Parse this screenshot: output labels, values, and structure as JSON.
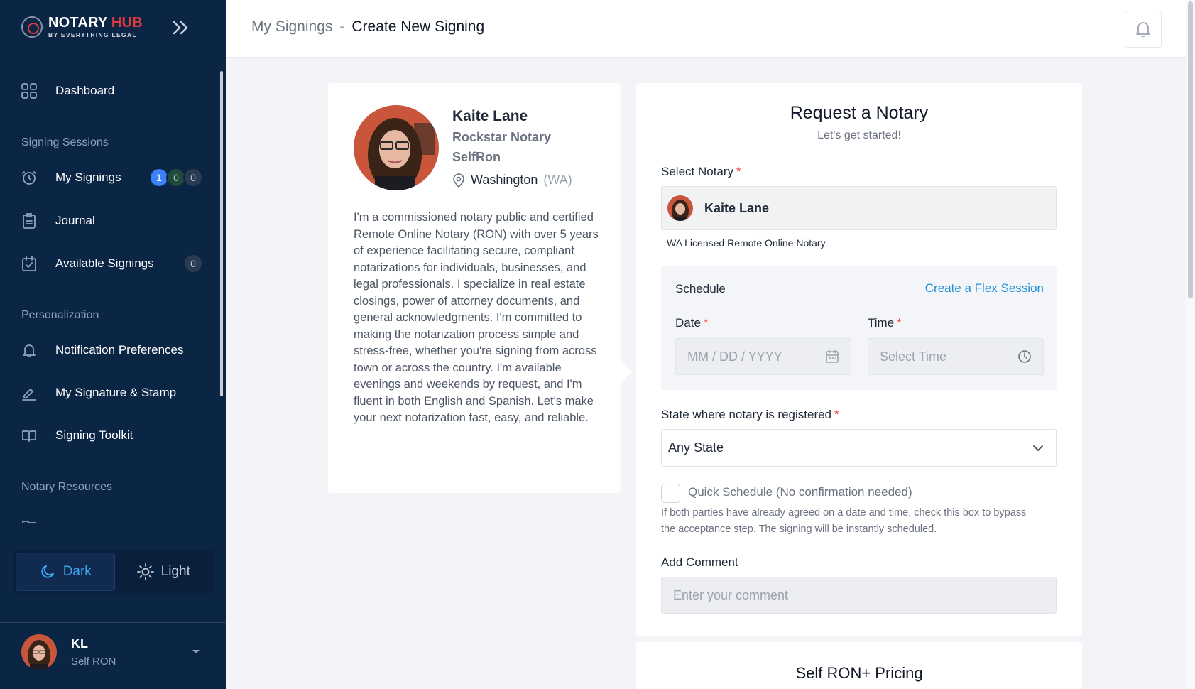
{
  "brand": {
    "name_main": "NOTARY",
    "name_accent": "HUB",
    "tagline": "BY EVERYTHING LEGAL"
  },
  "sidebar": {
    "dashboard_label": "Dashboard",
    "section_signing": "Signing Sessions",
    "my_signings_label": "My Signings",
    "my_signings_badges": [
      "1",
      "0",
      "0"
    ],
    "journal_label": "Journal",
    "available_label": "Available Signings",
    "available_count": "0",
    "section_personalization": "Personalization",
    "notification_label": "Notification Preferences",
    "signature_label": "My Signature & Stamp",
    "toolkit_label": "Signing Toolkit",
    "section_resources": "Notary Resources",
    "theme_dark": "Dark",
    "theme_light": "Light",
    "user_initials": "KL",
    "user_role": "Self RON"
  },
  "header": {
    "breadcrumb_parent": "My Signings",
    "breadcrumb_sep": "-",
    "breadcrumb_current": "Create New Signing"
  },
  "profile": {
    "name": "Kaite Lane",
    "title": "Rockstar Notary",
    "company": "SelfRon",
    "state": "Washington",
    "state_abbr": "(WA)",
    "bio": "I'm a commissioned notary public and certified Remote Online Notary (RON) with over 5 years of experience facilitating secure, compliant notarizations for individuals, businesses, and legal professionals. I specialize in real estate closings, power of attorney documents, and general acknowledgments. I'm committed to making the notarization process simple and stress-free, whether you're signing from across town or across the country. I'm available evenings and weekends by request, and I'm fluent in both English and Spanish. Let's make your next notarization fast, easy, and reliable."
  },
  "request": {
    "title": "Request a Notary",
    "subtitle": "Let's get started!",
    "select_notary_label": "Select Notary",
    "selected_notary": "Kaite Lane",
    "license_note": "WA Licensed Remote Online Notary",
    "schedule_title": "Schedule",
    "flex_link": "Create a Flex Session",
    "date_label": "Date",
    "date_placeholder": "MM / DD / YYYY",
    "time_label": "Time",
    "time_placeholder": "Select Time",
    "state_label": "State where notary is registered",
    "state_value": "Any State",
    "quick_label": "Quick Schedule (No confirmation needed)",
    "quick_checked": false,
    "quick_help": "If both parties have already agreed on a date and time, check this box to bypass the acceptance step. The signing will be instantly scheduled.",
    "comment_label": "Add Comment",
    "comment_placeholder": "Enter your comment",
    "required_mark": "*"
  },
  "pricing": {
    "title": "Self RON+ Pricing"
  },
  "colors": {
    "sidebar_bg": "#0b2545",
    "accent_blue": "#3b82f6",
    "link_blue": "#1e90d8",
    "brand_red": "#e23b3b",
    "required_red": "#ef4444"
  },
  "icons": [
    "logo-icon",
    "double-chevron-right-icon",
    "dashboard-grid-icon",
    "signing-clock-icon",
    "journal-clipboard-icon",
    "calendar-check-icon",
    "bell-icon",
    "pen-icon",
    "book-icon",
    "folder-icon",
    "moon-icon",
    "sun-icon",
    "caret-down-icon",
    "location-pin-icon",
    "calendar-icon",
    "clock-icon",
    "chevron-down-icon"
  ]
}
